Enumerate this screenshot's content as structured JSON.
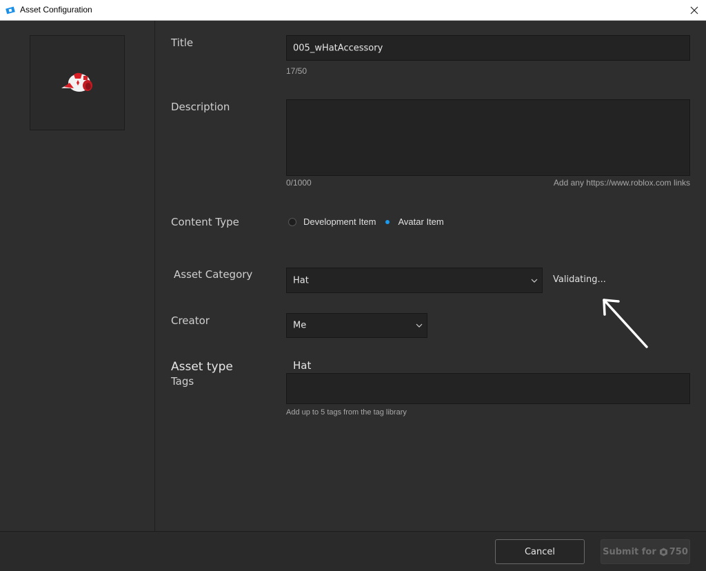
{
  "window": {
    "title": "Asset Configuration"
  },
  "form": {
    "title": {
      "label": "Title",
      "value": "005_wHatAccessory",
      "counter": "17/50"
    },
    "description": {
      "label": "Description",
      "value": "",
      "counter": "0/1000",
      "hint": "Add any https://www.roblox.com links"
    },
    "content_type": {
      "label": "Content Type",
      "options": [
        {
          "label": "Development Item",
          "selected": false
        },
        {
          "label": "Avatar Item",
          "selected": true
        }
      ]
    },
    "asset_category": {
      "label": "Asset Category",
      "value": "Hat",
      "status": "Validating..."
    },
    "creator": {
      "label": "Creator",
      "value": "Me"
    },
    "asset_type": {
      "label": "Asset type",
      "value": "Hat"
    },
    "tags": {
      "label": "Tags",
      "value": "",
      "hint": "Add up to 5 tags from the tag library"
    }
  },
  "footer": {
    "cancel_label": "Cancel",
    "submit_label": "Submit for",
    "submit_price": "750"
  },
  "colors": {
    "accent": "#1a9bf0",
    "background": "#2e2e2e",
    "field": "#232323"
  },
  "icons": [
    "roblox-studio-icon",
    "close-icon",
    "chevron-down-icon",
    "robux-icon",
    "arrow-annotation"
  ]
}
